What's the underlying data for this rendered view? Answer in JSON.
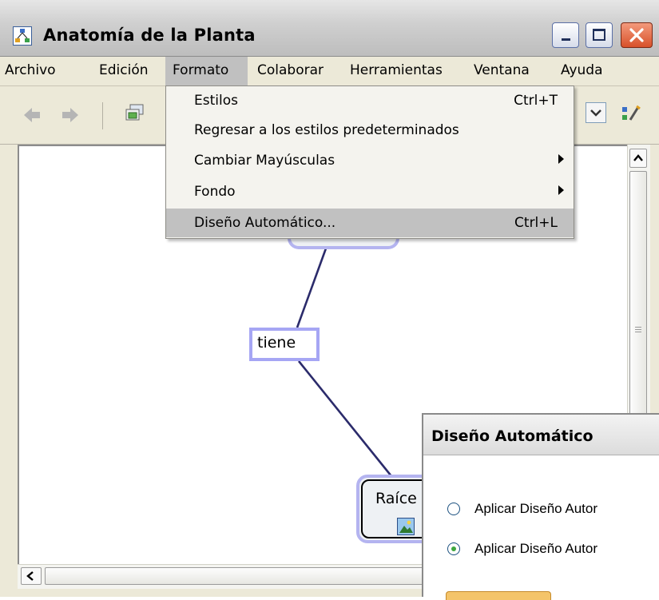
{
  "window": {
    "title": "Anatomía de la Planta",
    "icon": "app-concept-map-icon",
    "controls": [
      "minimize-icon",
      "maximize-icon",
      "close-icon"
    ]
  },
  "menubar": {
    "items": [
      "Archivo",
      "Edición",
      "Formato",
      "Colaborar",
      "Herramientas",
      "Ventana",
      "Ayuda"
    ],
    "active": "Formato"
  },
  "dropdown": {
    "items": [
      {
        "label": "Estilos",
        "shortcut": "Ctrl+T",
        "submenu": false
      },
      {
        "label": "Regresar a los estilos predeterminados",
        "shortcut": "",
        "submenu": false
      },
      {
        "label": "Cambiar Mayúsculas",
        "shortcut": "",
        "submenu": true
      },
      {
        "label": "Fondo",
        "shortcut": "",
        "submenu": true
      },
      {
        "label": "Diseño Automático...",
        "shortcut": "Ctrl+L",
        "submenu": false,
        "highlighted": true
      }
    ]
  },
  "toolbar": {
    "icons": [
      "back-arrow-icon",
      "forward-arrow-icon",
      "views-icon",
      "dropdown-arrow-icon",
      "styles-icon"
    ]
  },
  "concept_map": {
    "linking_phrase": "tiene",
    "concept_bottom": "Raíce",
    "line_color": "#2b2b6b",
    "node_border_color": "#a6a6f4"
  },
  "dialog": {
    "title": "Diseño Automático",
    "options": [
      {
        "label": "Aplicar Diseño Autor",
        "selected": false
      },
      {
        "label": "Aplicar Diseño Autor",
        "selected": true
      }
    ]
  },
  "colors": {
    "chrome": "#ece9d8",
    "menu_highlight": "#c1c1c1",
    "close_button": "#d8512a"
  }
}
